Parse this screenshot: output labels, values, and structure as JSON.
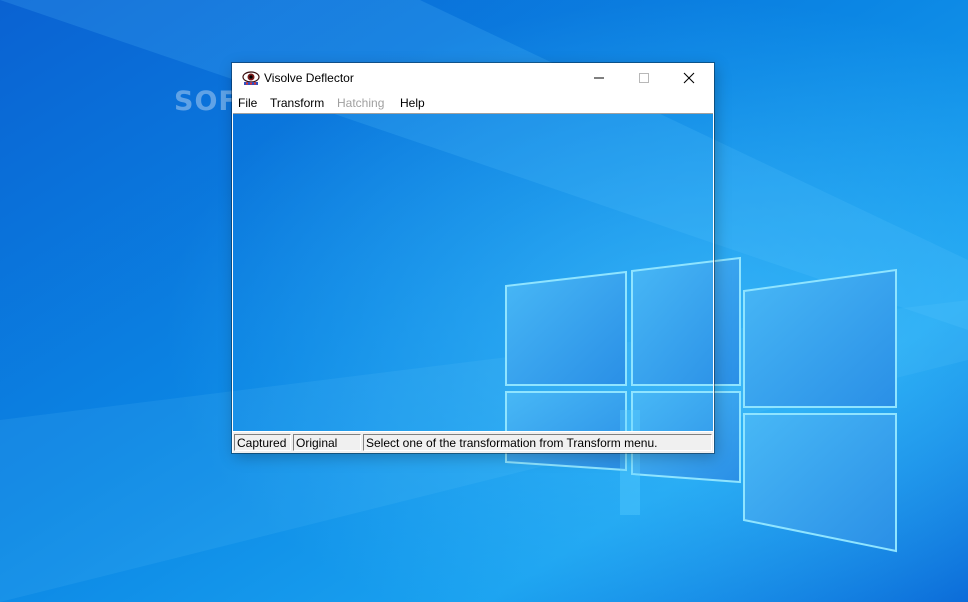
{
  "desktop": {
    "watermark": "SOFTPEDIA",
    "colors": {
      "bg_dark": "#0552c8",
      "bg_mid": "#0a78e0",
      "bg_light": "#24a8f5",
      "logo_pane": "#3aa2ee",
      "logo_glow": "#6fd8ff"
    }
  },
  "window": {
    "title": "Visolve Deflector",
    "icon": "eye-icon",
    "caption_buttons": {
      "minimize": "minimize-icon",
      "maximize": "maximize-icon",
      "close": "close-icon"
    },
    "menu": [
      {
        "label": "File",
        "enabled": true
      },
      {
        "label": "Transform",
        "enabled": true
      },
      {
        "label": "Hatching",
        "enabled": false
      },
      {
        "label": "Help",
        "enabled": true
      }
    ],
    "status": {
      "captured": "Captured",
      "original": "Original",
      "message": "Select one of the transformation from Transform menu."
    }
  }
}
